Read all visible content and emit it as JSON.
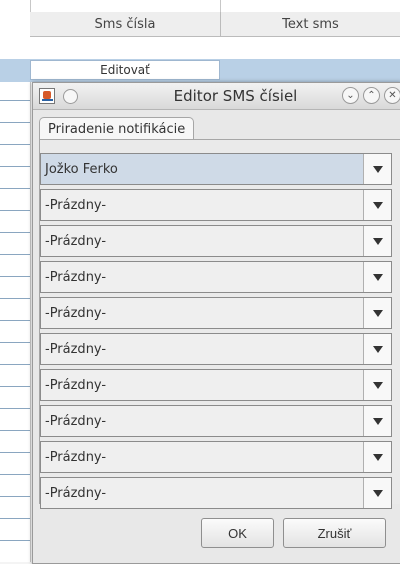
{
  "table": {
    "headers": [
      "Sms čísla",
      "Text sms"
    ],
    "edit_label": "Editovať"
  },
  "dialog": {
    "title": "Editor SMS čísiel",
    "tab_label": "Priradenie notifikácie",
    "items": [
      {
        "label": "Jožko Ferko"
      },
      {
        "label": "-Prázdny-"
      },
      {
        "label": "-Prázdny-"
      },
      {
        "label": "-Prázdny-"
      },
      {
        "label": "-Prázdny-"
      },
      {
        "label": "-Prázdny-"
      },
      {
        "label": "-Prázdny-"
      },
      {
        "label": "-Prázdny-"
      },
      {
        "label": "-Prázdny-"
      },
      {
        "label": "-Prázdny-"
      }
    ],
    "buttons": {
      "ok": "OK",
      "cancel": "Zrušiť"
    }
  }
}
